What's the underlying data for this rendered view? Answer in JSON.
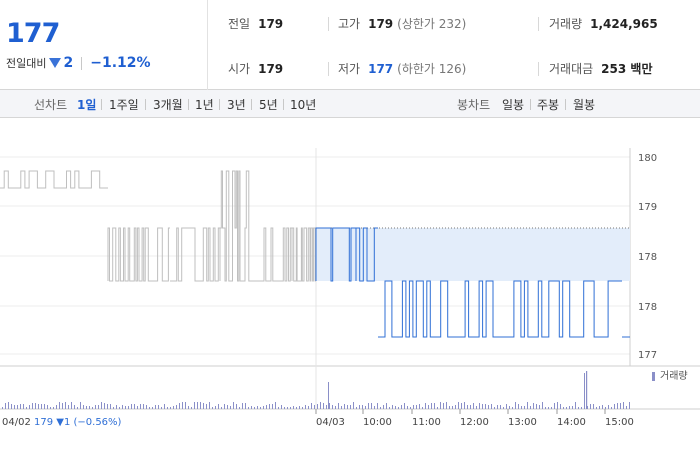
{
  "header": {
    "price": "177",
    "change_label": "전일대비",
    "change_value": "2",
    "change_rate": "−1.12%",
    "stats": {
      "prev_label": "전일",
      "prev_value": "179",
      "high_label": "고가",
      "high_value": "179",
      "upper_limit": "(상한가 232)",
      "volume_label": "거래량",
      "volume_value": "1,424,965",
      "open_label": "시가",
      "open_value": "179",
      "low_label": "저가",
      "low_value": "177",
      "lower_limit": "(하한가 126)",
      "amount_label": "거래대금",
      "amount_value": "253 백만"
    }
  },
  "period_bar": {
    "line_label": "선차트",
    "line_periods": [
      "1일",
      "1주일",
      "3개월",
      "1년",
      "3년",
      "5년",
      "10년"
    ],
    "active_period": "1일",
    "candle_label": "봉차트",
    "candle_periods": [
      "일봉",
      "주봉",
      "월봉"
    ]
  },
  "chart_data": {
    "type": "line",
    "title": "",
    "xlabel": "",
    "ylabel": "",
    "y_ticks": [
      "180",
      "179",
      "178",
      "178",
      "177"
    ],
    "y_range": [
      177,
      180
    ],
    "x_tick_labels": [
      "04/03",
      "10:00",
      "11:00",
      "12:00",
      "13:00",
      "14:00",
      "15:00"
    ],
    "prev_session_label": "04/02",
    "prev_session_summary": "179 ▼1 (−0.56%)",
    "volume_legend": "거래량",
    "reference_price": 178.6,
    "colors": {
      "previous": "#bfbfbf",
      "today": "#2f6fd6",
      "fill": "#e3edfa",
      "volume": "#8a8fc8",
      "grid": "#ececec"
    },
    "series": [
      {
        "session": "04/02",
        "segments": [
          {
            "levels": [
              178.75,
              179.5
            ],
            "density": 26
          },
          {
            "levels": [
              178.0,
              178.5
            ],
            "density": 40
          },
          {
            "levels": [
              178.0,
              178.5
            ],
            "density": 30
          },
          {
            "levels": [
              178.0,
              178.5,
              179.5
            ],
            "density": 24
          },
          {
            "levels": [
              178.0,
              178.5
            ],
            "density": 24
          },
          {
            "levels": [
              178.0,
              178.5
            ],
            "density": 28
          }
        ]
      },
      {
        "session": "04/03",
        "segments": [
          {
            "levels": [
              178.0,
              178.5,
              178.6
            ],
            "density": 24
          },
          {
            "levels": [
              178.0,
              178.5
            ],
            "density": 6
          },
          {
            "levels": [
              177.3,
              178.0
            ],
            "density": 70
          },
          {
            "levels": [
              177.3
            ],
            "density": 2
          }
        ]
      }
    ]
  }
}
